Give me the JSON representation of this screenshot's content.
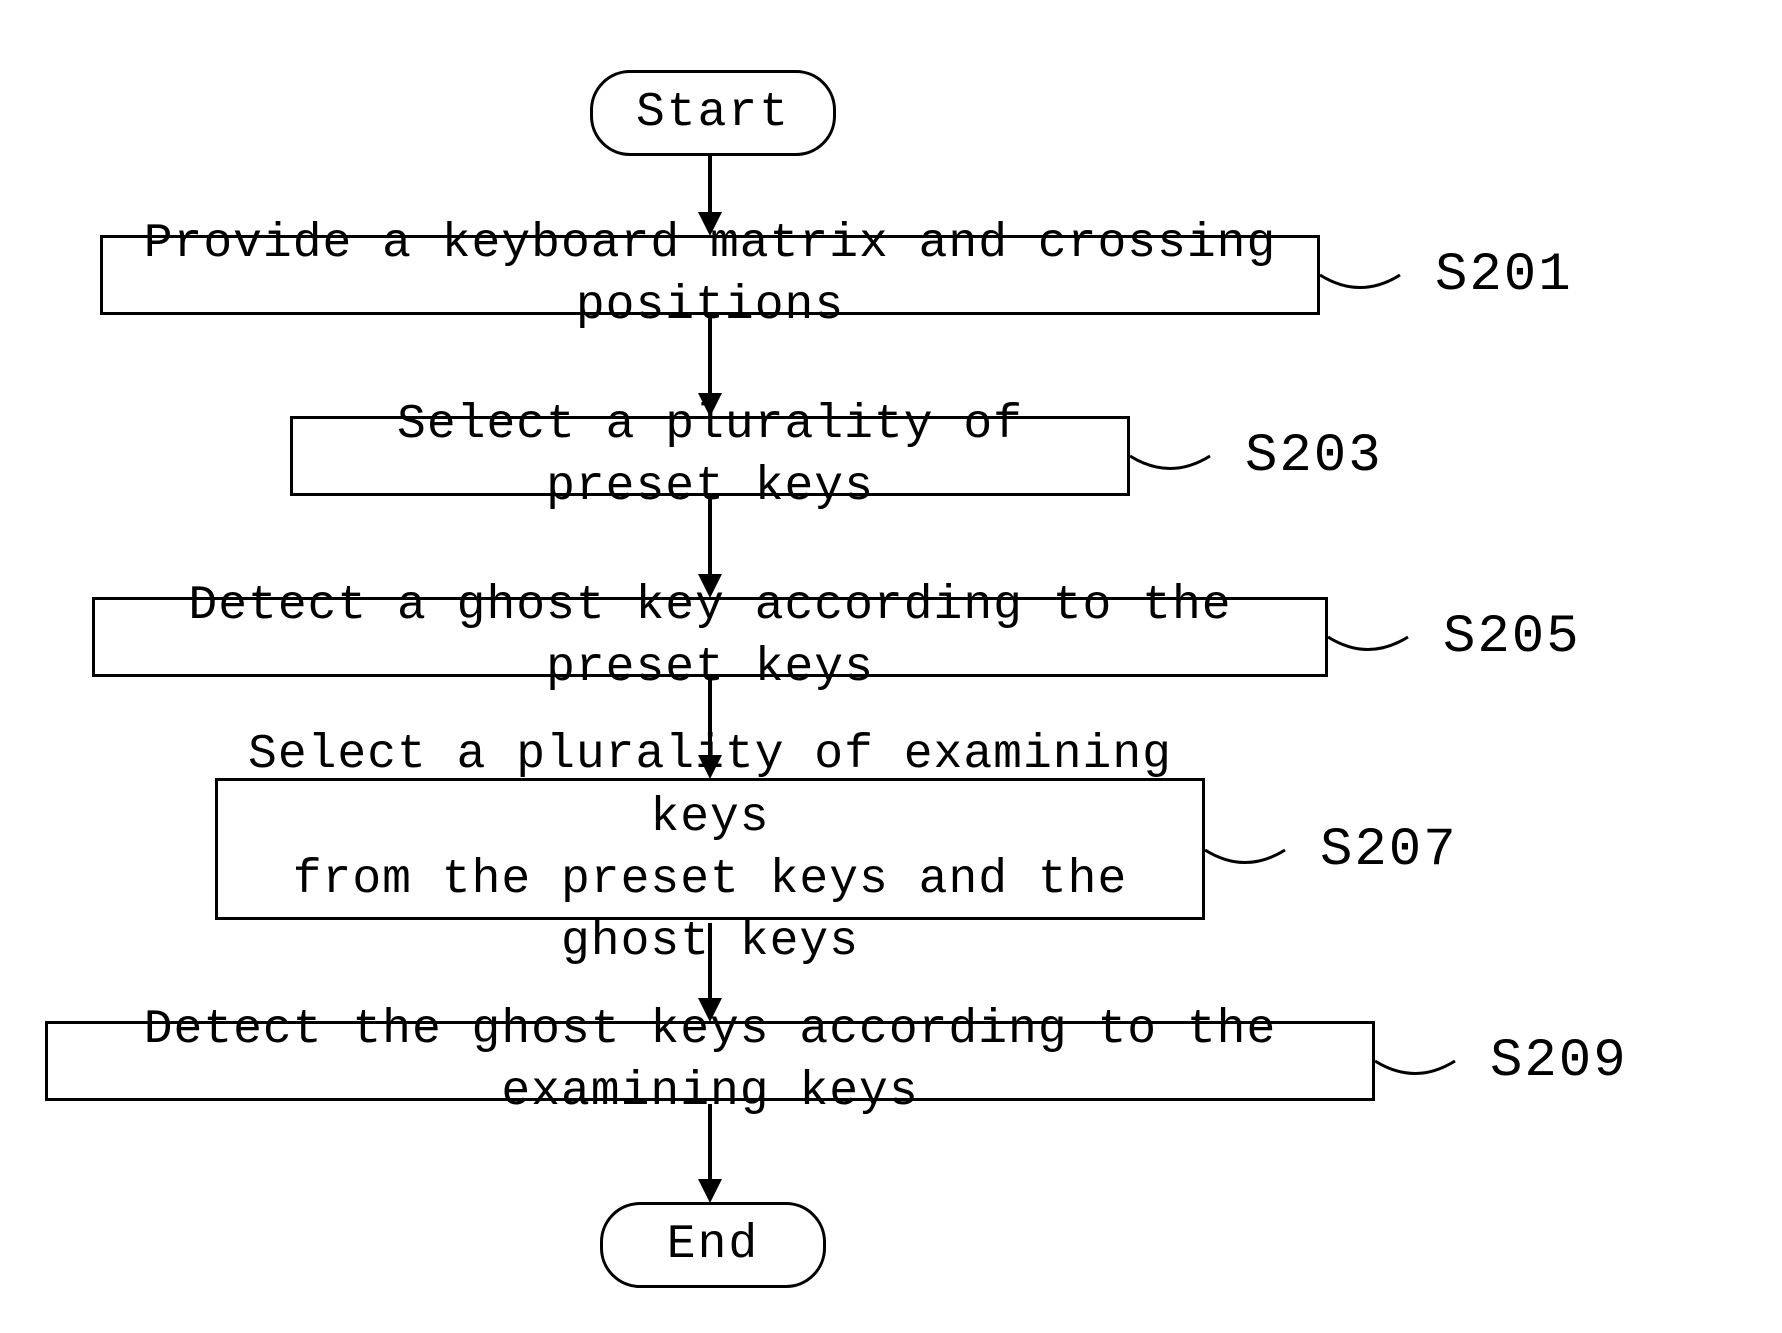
{
  "flowchart": {
    "start": "Start",
    "end": "End",
    "steps": [
      {
        "id": "S201",
        "text": "Provide a keyboard matrix and crossing positions"
      },
      {
        "id": "S203",
        "text": "Select a plurality of preset keys"
      },
      {
        "id": "S205",
        "text": "Detect a ghost key according to the preset keys"
      },
      {
        "id": "S207",
        "text": "Select a plurality of examining keys\n from the preset keys and the ghost keys"
      },
      {
        "id": "S209",
        "text": "Detect the ghost keys according to the examining keys"
      }
    ]
  }
}
